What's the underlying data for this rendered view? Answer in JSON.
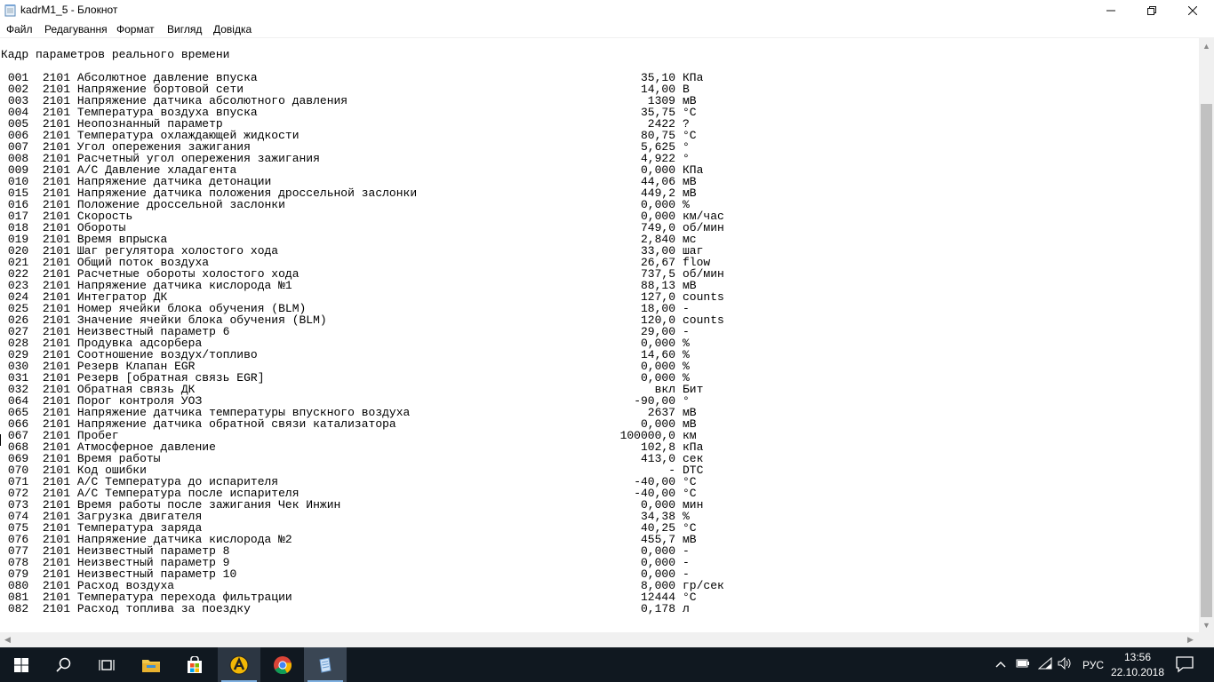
{
  "window": {
    "title": "kadrM1_5 - Блокнот",
    "minimize_icon": "minimize-icon",
    "maximize_icon": "restore-icon",
    "close_icon": "close-icon"
  },
  "menu": {
    "items": [
      "Файл",
      "Редагування",
      "Формат",
      "Вигляд",
      "Довідка"
    ]
  },
  "document": {
    "heading": "Кадр параметров реального времени",
    "rows": [
      {
        "num": "001",
        "code": "2101",
        "name": "Абсолютное давление впуска",
        "value": "35,10",
        "unit": "КПа"
      },
      {
        "num": "002",
        "code": "2101",
        "name": "Напряжение бортовой сети",
        "value": "14,00",
        "unit": "В"
      },
      {
        "num": "003",
        "code": "2101",
        "name": "Напряжение датчика абсолютного давления",
        "value": "1309",
        "unit": "мВ"
      },
      {
        "num": "004",
        "code": "2101",
        "name": "Температура воздуха впуска",
        "value": "35,75",
        "unit": "°C"
      },
      {
        "num": "005",
        "code": "2101",
        "name": "Неопознанный параметр",
        "value": "2422",
        "unit": "?"
      },
      {
        "num": "006",
        "code": "2101",
        "name": "Температура охлаждающей жидкости",
        "value": "80,75",
        "unit": "°C"
      },
      {
        "num": "007",
        "code": "2101",
        "name": "Угол опережения зажигания",
        "value": "5,625",
        "unit": "°"
      },
      {
        "num": "008",
        "code": "2101",
        "name": "Расчетный угол опережения зажигания",
        "value": "4,922",
        "unit": "°"
      },
      {
        "num": "009",
        "code": "2101",
        "name": "A/C Давление хладагента",
        "value": "0,000",
        "unit": "КПа"
      },
      {
        "num": "010",
        "code": "2101",
        "name": "Напряжение датчика детонации",
        "value": "44,06",
        "unit": "мВ"
      },
      {
        "num": "015",
        "code": "2101",
        "name": "Напряжение датчика положения дроссельной заслонки",
        "value": "449,2",
        "unit": "мВ"
      },
      {
        "num": "016",
        "code": "2101",
        "name": "Положение дроссельной заслонки",
        "value": "0,000",
        "unit": "%"
      },
      {
        "num": "017",
        "code": "2101",
        "name": "Скорость",
        "value": "0,000",
        "unit": "км/час"
      },
      {
        "num": "018",
        "code": "2101",
        "name": "Обороты",
        "value": "749,0",
        "unit": "об/мин"
      },
      {
        "num": "019",
        "code": "2101",
        "name": "Время впрыска",
        "value": "2,840",
        "unit": "мс"
      },
      {
        "num": "020",
        "code": "2101",
        "name": "Шаг регулятора холостого хода",
        "value": "33,00",
        "unit": "шаг"
      },
      {
        "num": "021",
        "code": "2101",
        "name": "Общий поток воздуха",
        "value": "26,67",
        "unit": "flow"
      },
      {
        "num": "022",
        "code": "2101",
        "name": "Расчетные обороты холостого хода",
        "value": "737,5",
        "unit": "об/мин"
      },
      {
        "num": "023",
        "code": "2101",
        "name": "Напряжение датчика кислорода №1",
        "value": "88,13",
        "unit": "мВ"
      },
      {
        "num": "024",
        "code": "2101",
        "name": "Интегратор ДК",
        "value": "127,0",
        "unit": "counts"
      },
      {
        "num": "025",
        "code": "2101",
        "name": "Номер ячейки блока обучения (BLM)",
        "value": "18,00",
        "unit": "-"
      },
      {
        "num": "026",
        "code": "2101",
        "name": "Значение ячейки блока обучения (BLM)",
        "value": "120,0",
        "unit": "counts"
      },
      {
        "num": "027",
        "code": "2101",
        "name": "Неизвестный параметр 6",
        "value": "29,00",
        "unit": "-"
      },
      {
        "num": "028",
        "code": "2101",
        "name": "Продувка адсорбера",
        "value": "0,000",
        "unit": "%"
      },
      {
        "num": "029",
        "code": "2101",
        "name": "Соотношение воздух/топливо",
        "value": "14,60",
        "unit": "%"
      },
      {
        "num": "030",
        "code": "2101",
        "name": "Резерв Клапан EGR",
        "value": "0,000",
        "unit": "%"
      },
      {
        "num": "031",
        "code": "2101",
        "name": "Резерв [обратная связь EGR]",
        "value": "0,000",
        "unit": "%"
      },
      {
        "num": "032",
        "code": "2101",
        "name": "Обратная связь ДК",
        "value": "вкл",
        "unit": "Бит"
      },
      {
        "num": "064",
        "code": "2101",
        "name": "Порог контроля УОЗ",
        "value": "-90,00",
        "unit": "°"
      },
      {
        "num": "065",
        "code": "2101",
        "name": "Напряжение датчика температуры впускного воздуха",
        "value": "2637",
        "unit": "мВ"
      },
      {
        "num": "066",
        "code": "2101",
        "name": "Напряжение датчика обратной связи катализатора",
        "value": "0,000",
        "unit": "мВ"
      },
      {
        "num": "067",
        "code": "2101",
        "name": "Пробег",
        "value": "100000,0",
        "unit": "км"
      },
      {
        "num": "068",
        "code": "2101",
        "name": "Атмосферное давление",
        "value": "102,8",
        "unit": "кПа"
      },
      {
        "num": "069",
        "code": "2101",
        "name": "Время работы",
        "value": "413,0",
        "unit": "сек"
      },
      {
        "num": "070",
        "code": "2101",
        "name": "Код ошибки",
        "value": "-",
        "unit": "DTC"
      },
      {
        "num": "071",
        "code": "2101",
        "name": "A/C Температура до испарителя",
        "value": "-40,00",
        "unit": "°C"
      },
      {
        "num": "072",
        "code": "2101",
        "name": "A/C Температура после испарителя",
        "value": "-40,00",
        "unit": "°C"
      },
      {
        "num": "073",
        "code": "2101",
        "name": "Время работы после зажигания Чек Инжин",
        "value": "0,000",
        "unit": "мин"
      },
      {
        "num": "074",
        "code": "2101",
        "name": "Загрузка двигателя",
        "value": "34,38",
        "unit": "%"
      },
      {
        "num": "075",
        "code": "2101",
        "name": "Температура заряда",
        "value": "40,25",
        "unit": "°C"
      },
      {
        "num": "076",
        "code": "2101",
        "name": "Напряжение датчика кислорода №2",
        "value": "455,7",
        "unit": "мВ"
      },
      {
        "num": "077",
        "code": "2101",
        "name": "Неизвестный параметр 8",
        "value": "0,000",
        "unit": "-"
      },
      {
        "num": "078",
        "code": "2101",
        "name": "Неизвестный параметр 9",
        "value": "0,000",
        "unit": "-"
      },
      {
        "num": "079",
        "code": "2101",
        "name": "Неизвестный параметр 10",
        "value": "0,000",
        "unit": "-"
      },
      {
        "num": "080",
        "code": "2101",
        "name": "Расход воздуха",
        "value": "8,000",
        "unit": "гр/сек"
      },
      {
        "num": "081",
        "code": "2101",
        "name": "Температура перехода фильтрации",
        "value": "12444",
        "unit": "°C"
      },
      {
        "num": "082",
        "code": "2101",
        "name": "Расход топлива за поездку",
        "value": "0,178",
        "unit": "л"
      }
    ]
  },
  "taskbar": {
    "buttons": [
      {
        "name": "start-button",
        "icon": "windows-logo-icon"
      },
      {
        "name": "search-button",
        "icon": "search-icon"
      },
      {
        "name": "task-view-button",
        "icon": "task-view-icon"
      },
      {
        "name": "file-explorer-button",
        "icon": "folder-icon"
      },
      {
        "name": "store-button",
        "icon": "store-icon"
      },
      {
        "name": "diagnostic-app-button",
        "icon": "app-logo-icon"
      },
      {
        "name": "chrome-button",
        "icon": "chrome-icon"
      },
      {
        "name": "notepad-button",
        "icon": "notepad-icon"
      }
    ],
    "tray": {
      "language": "РУС",
      "time": "13:56",
      "date": "22.10.2018"
    }
  }
}
